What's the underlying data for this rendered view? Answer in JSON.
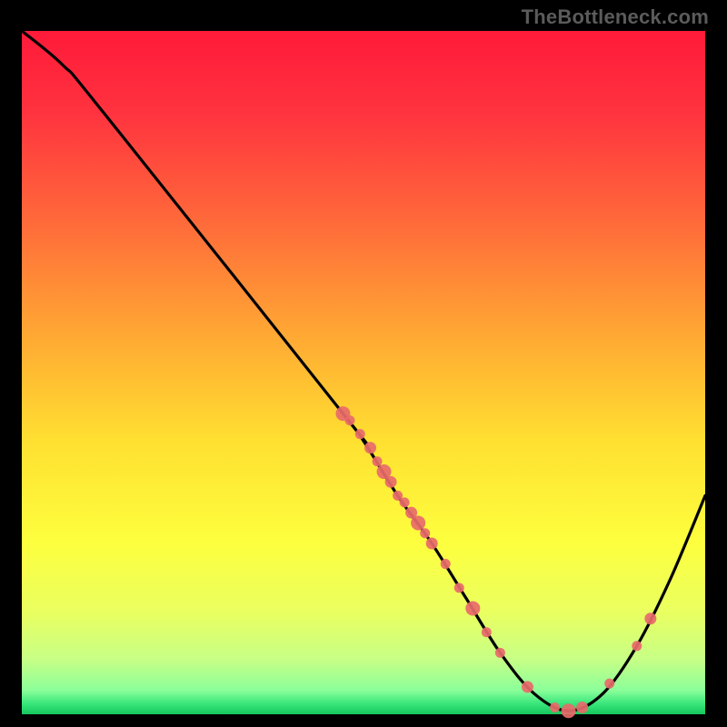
{
  "watermark": "TheBottleneck.com",
  "chart_data": {
    "type": "line",
    "title": "",
    "xlabel": "",
    "ylabel": "",
    "xlim": [
      0,
      100
    ],
    "ylim": [
      0,
      100
    ],
    "grid": false,
    "legend": false,
    "series": [
      {
        "name": "bottleneck-curve",
        "points": [
          {
            "x": 0,
            "y": 100
          },
          {
            "x": 6,
            "y": 95
          },
          {
            "x": 12,
            "y": 88
          },
          {
            "x": 47,
            "y": 44
          },
          {
            "x": 50,
            "y": 40
          },
          {
            "x": 55,
            "y": 32
          },
          {
            "x": 60,
            "y": 25
          },
          {
            "x": 65,
            "y": 17
          },
          {
            "x": 70,
            "y": 9
          },
          {
            "x": 75,
            "y": 3
          },
          {
            "x": 80,
            "y": 0.5
          },
          {
            "x": 85,
            "y": 3
          },
          {
            "x": 90,
            "y": 10
          },
          {
            "x": 95,
            "y": 20
          },
          {
            "x": 100,
            "y": 32
          }
        ]
      }
    ],
    "highlight_points": [
      {
        "x": 47,
        "y": 44
      },
      {
        "x": 48,
        "y": 43
      },
      {
        "x": 49.5,
        "y": 41
      },
      {
        "x": 51,
        "y": 39
      },
      {
        "x": 52,
        "y": 37
      },
      {
        "x": 53,
        "y": 35.5
      },
      {
        "x": 54,
        "y": 34
      },
      {
        "x": 55,
        "y": 32
      },
      {
        "x": 56,
        "y": 31
      },
      {
        "x": 57,
        "y": 29.5
      },
      {
        "x": 58,
        "y": 28
      },
      {
        "x": 59,
        "y": 26.5
      },
      {
        "x": 60,
        "y": 25
      },
      {
        "x": 62,
        "y": 22
      },
      {
        "x": 64,
        "y": 18.5
      },
      {
        "x": 66,
        "y": 15.5
      },
      {
        "x": 68,
        "y": 12
      },
      {
        "x": 70,
        "y": 9
      },
      {
        "x": 74,
        "y": 4
      },
      {
        "x": 78,
        "y": 1
      },
      {
        "x": 80,
        "y": 0.5
      },
      {
        "x": 82,
        "y": 1
      },
      {
        "x": 86,
        "y": 4.5
      },
      {
        "x": 90,
        "y": 10
      },
      {
        "x": 92,
        "y": 14
      }
    ],
    "gradient_stops": [
      {
        "offset": 0.0,
        "color": "#ff1a3a"
      },
      {
        "offset": 0.12,
        "color": "#ff333f"
      },
      {
        "offset": 0.28,
        "color": "#ff6a3a"
      },
      {
        "offset": 0.45,
        "color": "#ffaa33"
      },
      {
        "offset": 0.6,
        "color": "#ffe031"
      },
      {
        "offset": 0.75,
        "color": "#fdff3e"
      },
      {
        "offset": 0.85,
        "color": "#eaff60"
      },
      {
        "offset": 0.92,
        "color": "#c7ff86"
      },
      {
        "offset": 0.965,
        "color": "#8bff9a"
      },
      {
        "offset": 0.985,
        "color": "#37e57a"
      },
      {
        "offset": 1.0,
        "color": "#16c75d"
      }
    ]
  }
}
